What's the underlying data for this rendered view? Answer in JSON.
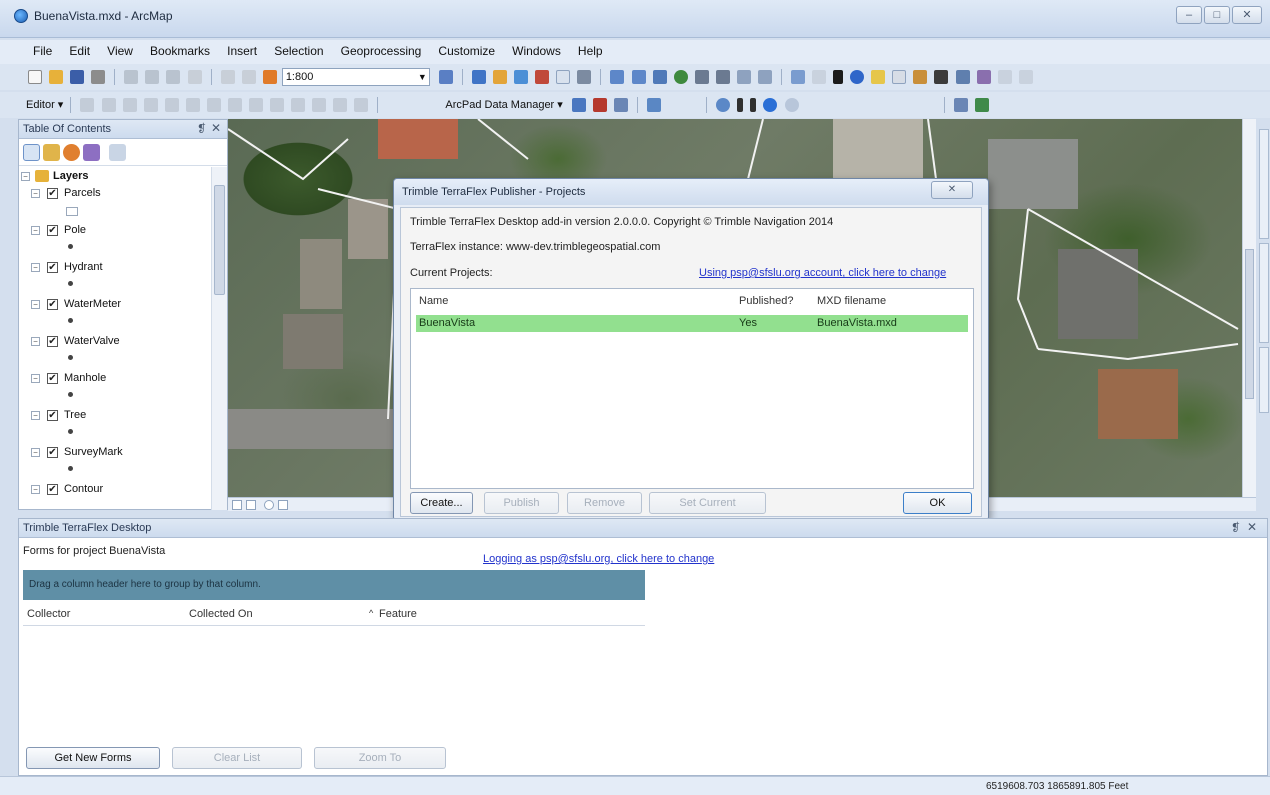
{
  "window": {
    "title": "BuenaVista.mxd - ArcMap",
    "controls": [
      "–",
      "□",
      "✕"
    ]
  },
  "menu": [
    "File",
    "Edit",
    "View",
    "Bookmarks",
    "Insert",
    "Selection",
    "Geoprocessing",
    "Customize",
    "Windows",
    "Help"
  ],
  "toolbar": {
    "scale": "1:800",
    "editor_label": "Editor ▾",
    "arcpad_label": "ArcPad Data Manager ▾"
  },
  "toc": {
    "title": "Table Of Contents",
    "pin": "❡",
    "close": "✕",
    "group_label": "Layers",
    "layers": [
      {
        "name": "Parcels"
      },
      {
        "name": "Pole"
      },
      {
        "name": "Hydrant"
      },
      {
        "name": "WaterMeter"
      },
      {
        "name": "WaterValve"
      },
      {
        "name": "Manhole"
      },
      {
        "name": "Tree"
      },
      {
        "name": "SurveyMark"
      },
      {
        "name": "Contour"
      }
    ]
  },
  "dialog": {
    "title": "Trimble TerraFlex Publisher - Projects",
    "close": "✕",
    "version_text": "Trimble TerraFlex Desktop add-in version 2.0.0.0. Copyright © Trimble Navigation 2014",
    "instance_text": "TerraFlex instance: www-dev.trimblegeospatial.com",
    "current_projects_label": "Current Projects:",
    "account_link": "Using psp@sfslu.org account, click here to change",
    "columns": [
      "Name",
      "Published?",
      "MXD filename"
    ],
    "rows": [
      {
        "name": "BuenaVista",
        "published": "Yes",
        "mxd": "BuenaVista.mxd"
      }
    ],
    "buttons": {
      "create": "Create...",
      "publish": "Publish",
      "remove": "Remove",
      "set_current": "Set Current",
      "ok": "OK"
    }
  },
  "terraflex": {
    "title": "Trimble TerraFlex Desktop",
    "pin": "❡",
    "close": "✕",
    "forms_label": "Forms for project BuenaVista",
    "login_link": "Logging as psp@sfslu.org, click here to change",
    "group_hint": "Drag a column header here to group by that column.",
    "columns": [
      "Collector",
      "Collected On",
      "Feature"
    ],
    "sort_indicator": "^",
    "buttons": {
      "get_new_forms": "Get New Forms",
      "clear_list": "Clear List",
      "zoom_to": "Zoom To"
    }
  },
  "status": {
    "coordinates": "6519608.703  1865891.805 Feet"
  },
  "colors": {
    "selected_row": "#92e08f",
    "group_bar": "#5f8fa6",
    "link": "#2233cc"
  }
}
